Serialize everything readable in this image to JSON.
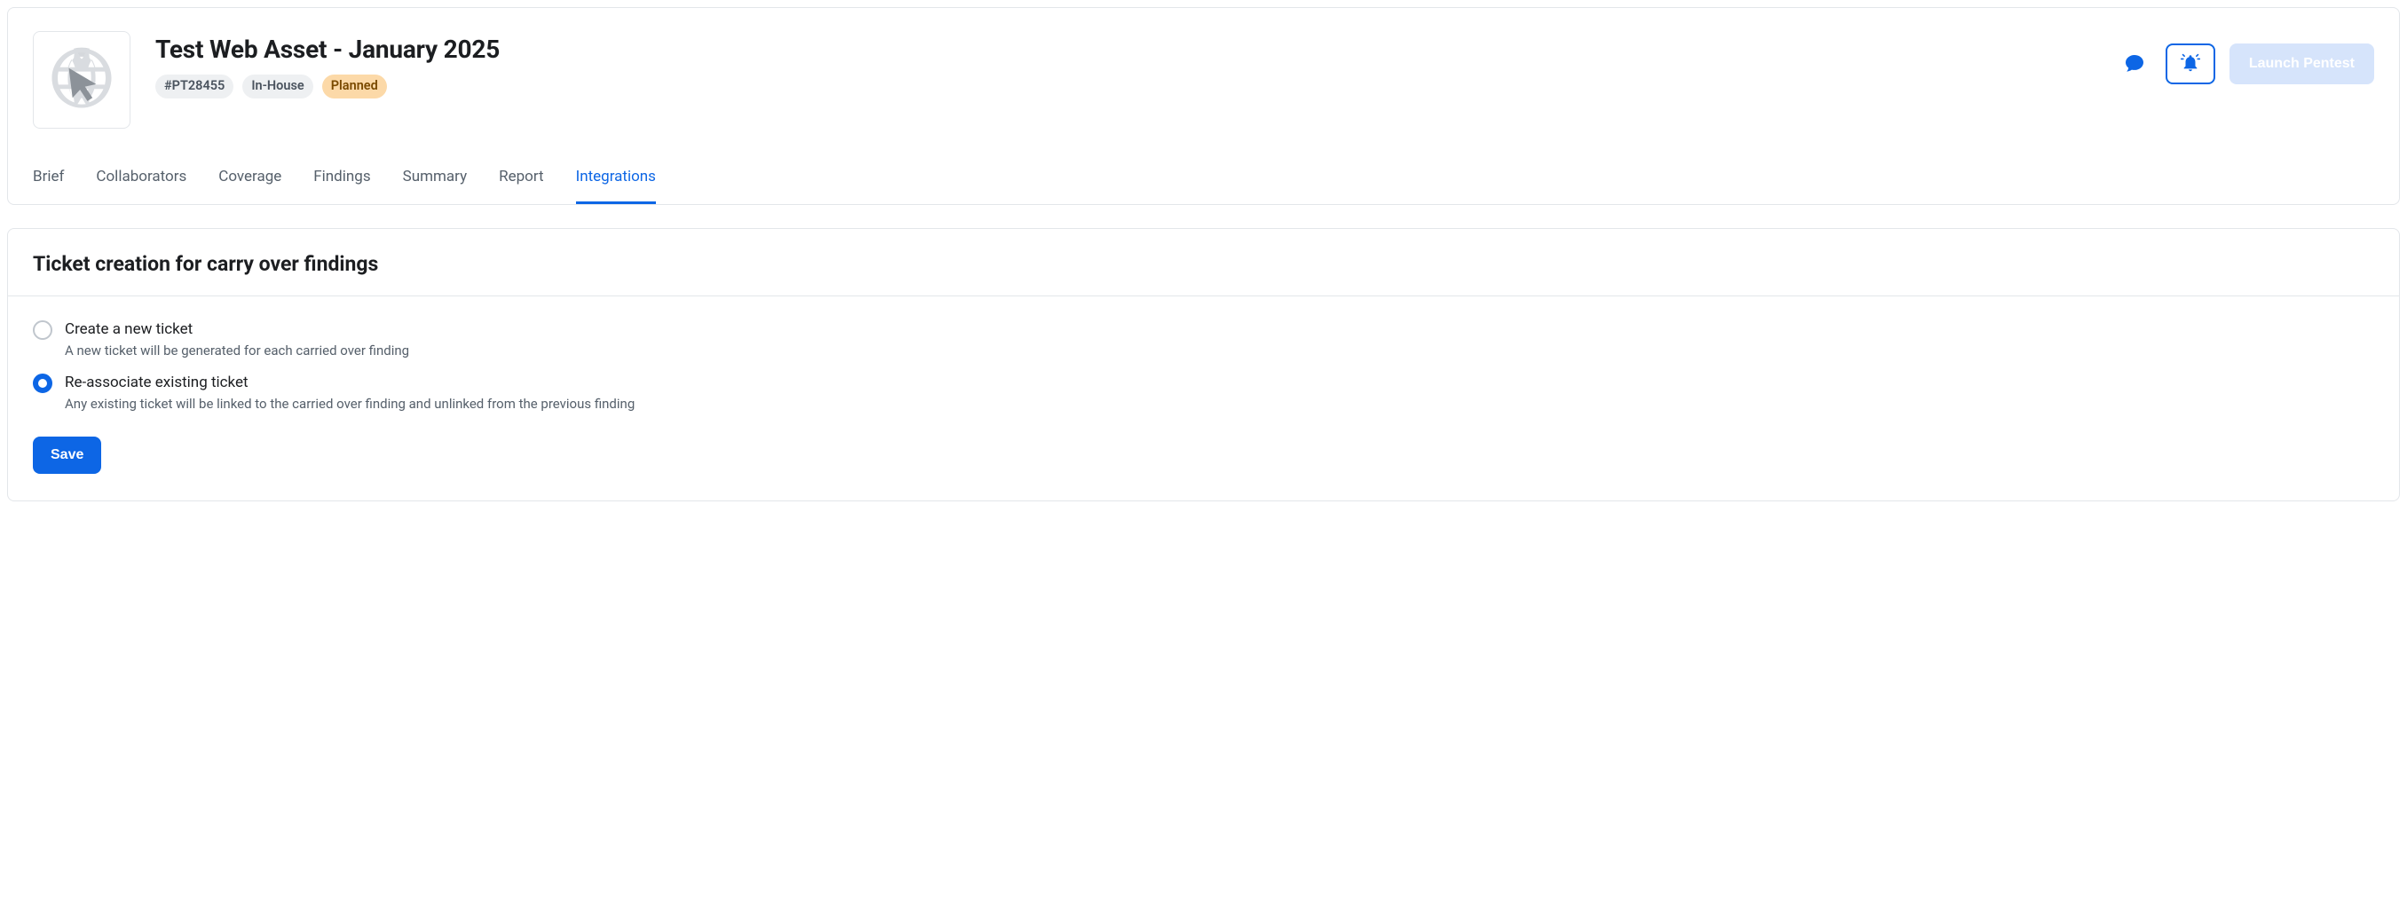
{
  "header": {
    "title": "Test Web Asset - January 2025",
    "id_chip": "#PT28455",
    "type_chip": "In-House",
    "status_chip": "Planned",
    "launch_label": "Launch Pentest"
  },
  "tabs": [
    {
      "label": "Brief",
      "active": false
    },
    {
      "label": "Collaborators",
      "active": false
    },
    {
      "label": "Coverage",
      "active": false
    },
    {
      "label": "Findings",
      "active": false
    },
    {
      "label": "Summary",
      "active": false
    },
    {
      "label": "Report",
      "active": false
    },
    {
      "label": "Integrations",
      "active": true
    }
  ],
  "section": {
    "heading": "Ticket creation for carry over findings",
    "options": [
      {
        "label": "Create a new ticket",
        "desc": "A new ticket will be generated for each carried over finding",
        "checked": false
      },
      {
        "label": "Re-associate existing ticket",
        "desc": "Any existing ticket will be linked to the carried over finding and unlinked from the previous finding",
        "checked": true
      }
    ],
    "save_label": "Save"
  }
}
